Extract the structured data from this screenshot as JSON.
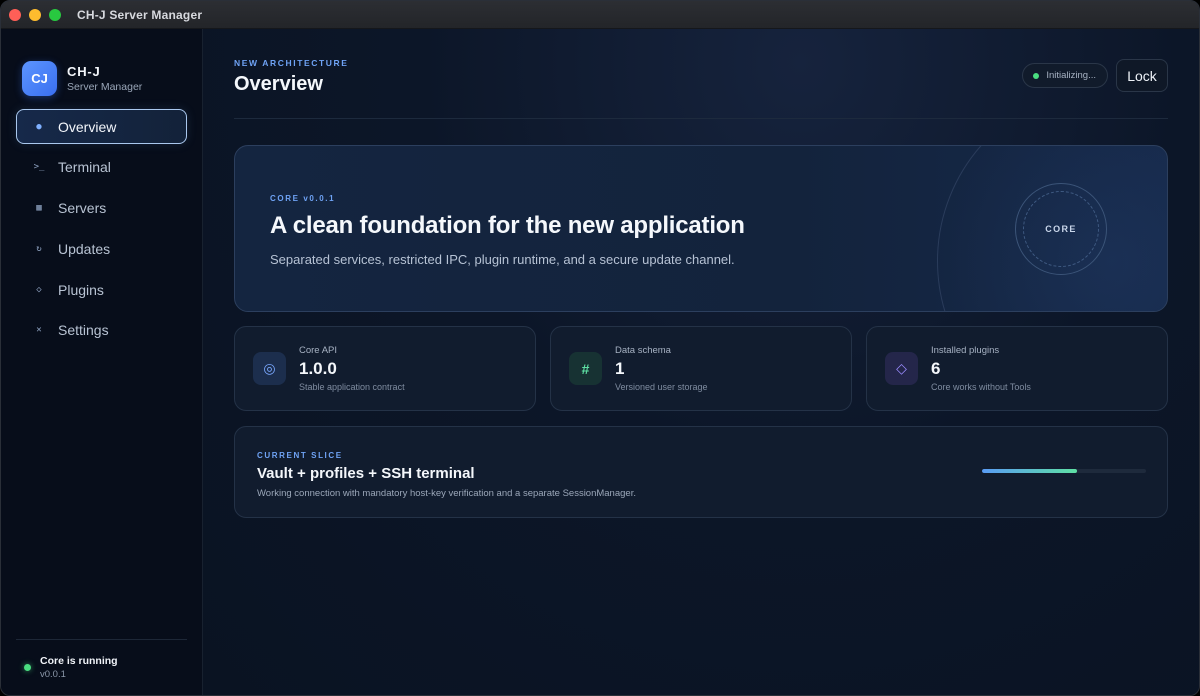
{
  "window": {
    "title": "CH-J Server Manager"
  },
  "brand": {
    "logo": "CJ",
    "name": "CH-J",
    "subtitle": "Server Manager"
  },
  "sidebar": {
    "items": [
      {
        "label": "Overview",
        "icon": "●",
        "icon_name": "dot-icon",
        "active": true
      },
      {
        "label": "Terminal",
        "icon": ">_",
        "icon_name": "terminal-icon",
        "active": false
      },
      {
        "label": "Servers",
        "icon": "▦",
        "icon_name": "servers-icon",
        "active": false
      },
      {
        "label": "Updates",
        "icon": "↻",
        "icon_name": "updates-icon",
        "active": false
      },
      {
        "label": "Plugins",
        "icon": "◇",
        "icon_name": "plugins-icon",
        "active": false
      },
      {
        "label": "Settings",
        "icon": "✕",
        "icon_name": "settings-icon",
        "active": false
      }
    ],
    "footer": {
      "title": "Core is running",
      "version": "v0.0.1"
    }
  },
  "header": {
    "eyebrow": "NEW ARCHITECTURE",
    "title": "Overview",
    "status": "Initializing...",
    "lock_label": "Lock"
  },
  "hero": {
    "eyebrow": "CORE v0.0.1",
    "title": "A clean foundation for the new application",
    "description": "Separated services, restricted IPC, plugin runtime, and a secure update channel.",
    "badge": "CORE"
  },
  "stats": [
    {
      "label": "Core API",
      "value": "1.0.0",
      "desc": "Stable application contract",
      "icon": "◎",
      "icon_name": "core-api-icon"
    },
    {
      "label": "Data schema",
      "value": "1",
      "desc": "Versioned user storage",
      "icon": "#",
      "icon_name": "hash-icon"
    },
    {
      "label": "Installed plugins",
      "value": "6",
      "desc": "Core works without Tools",
      "icon": "◇",
      "icon_name": "plugin-diamond-icon"
    }
  ],
  "slice": {
    "eyebrow": "CURRENT SLICE",
    "title": "Vault + profiles + SSH terminal",
    "description": "Working connection with mandatory host-key verification and a separate SessionManager.",
    "progress": 0.58
  },
  "colors": {
    "accent": "#6fa3f5",
    "status_ok": "#4ade80",
    "progress_start": "#5a9cf5",
    "progress_end": "#5ee0a4"
  }
}
